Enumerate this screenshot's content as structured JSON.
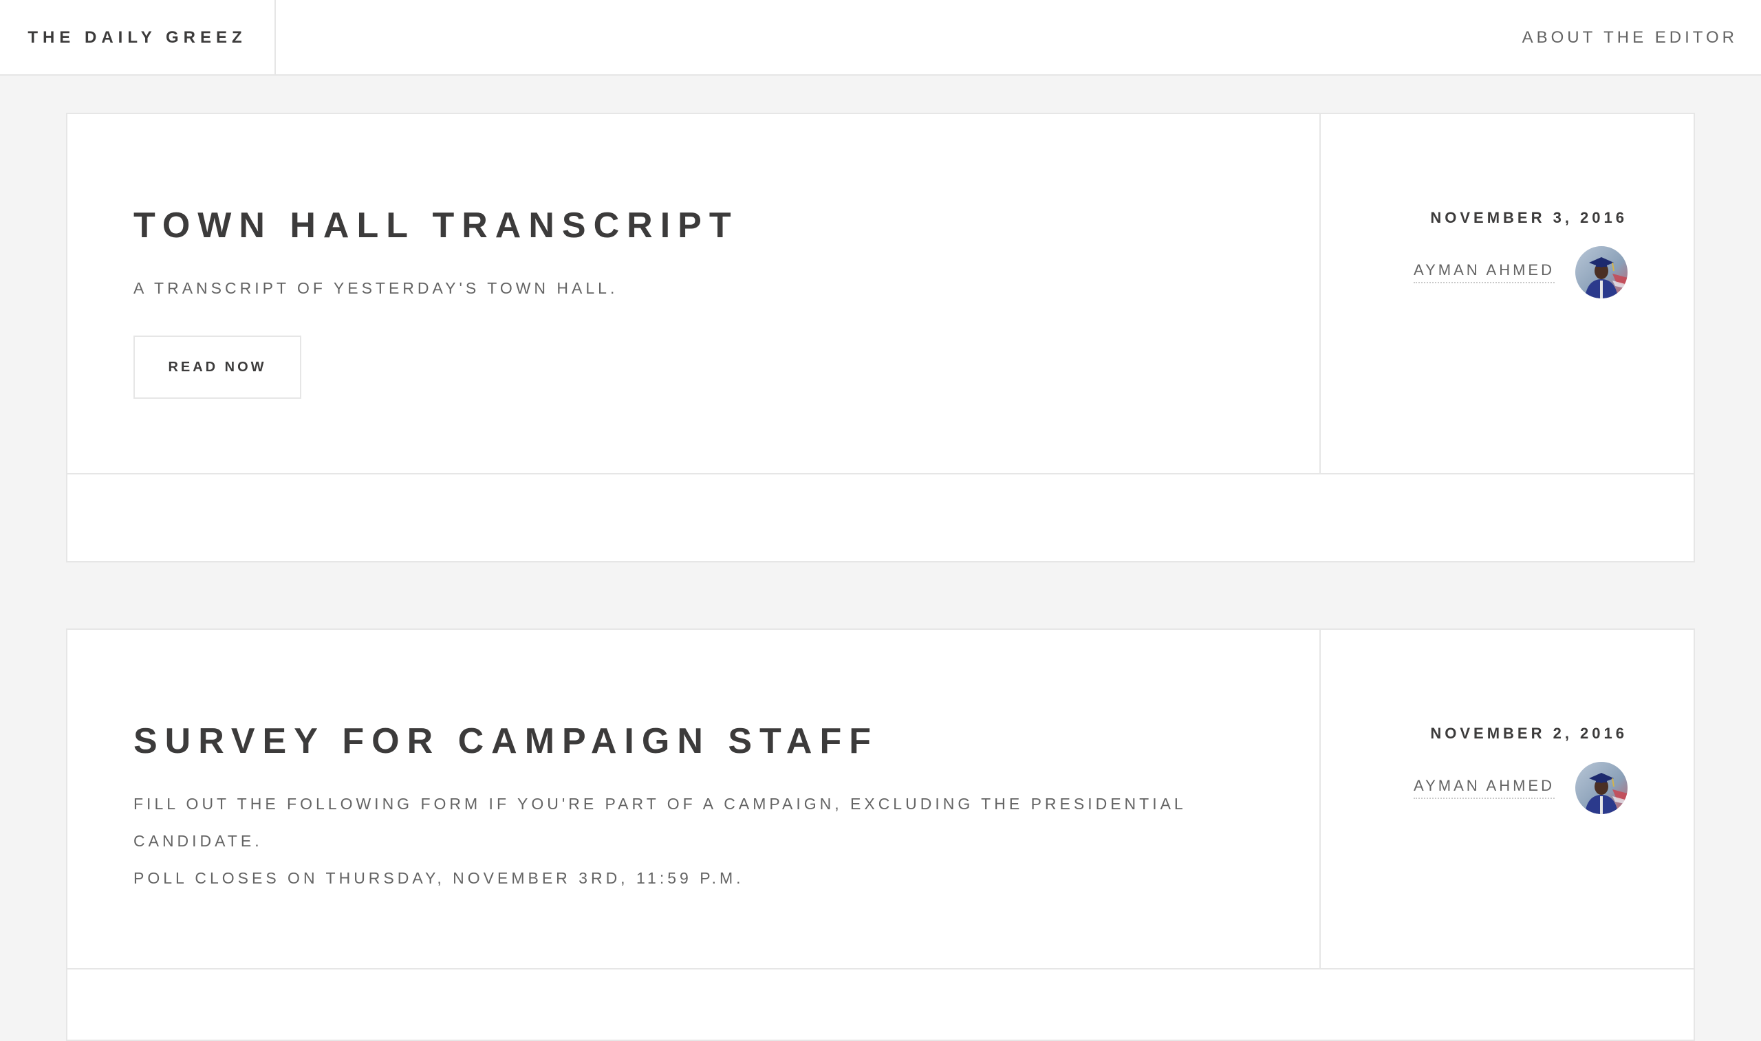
{
  "header": {
    "brand": "THE DAILY GREEZ",
    "nav": {
      "about_label": "ABOUT THE EDITOR"
    }
  },
  "posts": [
    {
      "title": "TOWN HALL TRANSCRIPT",
      "description": [
        "A TRANSCRIPT OF YESTERDAY'S TOWN HALL."
      ],
      "button_label": "READ NOW",
      "date": "NOVEMBER 3, 2016",
      "author": {
        "name": "AYMAN AHMED",
        "avatar_icon": "author-avatar"
      }
    },
    {
      "title": "SURVEY FOR CAMPAIGN STAFF",
      "description": [
        "FILL OUT THE FOLLOWING FORM IF YOU'RE PART OF A CAMPAIGN, EXCLUDING THE PRESIDENTIAL",
        "CANDIDATE.",
        "POLL CLOSES ON THURSDAY, NOVEMBER 3RD, 11:59 P.M."
      ],
      "date": "NOVEMBER 2, 2016",
      "author": {
        "name": "AYMAN AHMED",
        "avatar_icon": "author-avatar"
      }
    }
  ],
  "colors": {
    "background": "#f4f4f4",
    "card": "#ffffff",
    "border": "#e6e6e6",
    "text_dark": "#3c3b3b",
    "text_muted": "#646464"
  }
}
